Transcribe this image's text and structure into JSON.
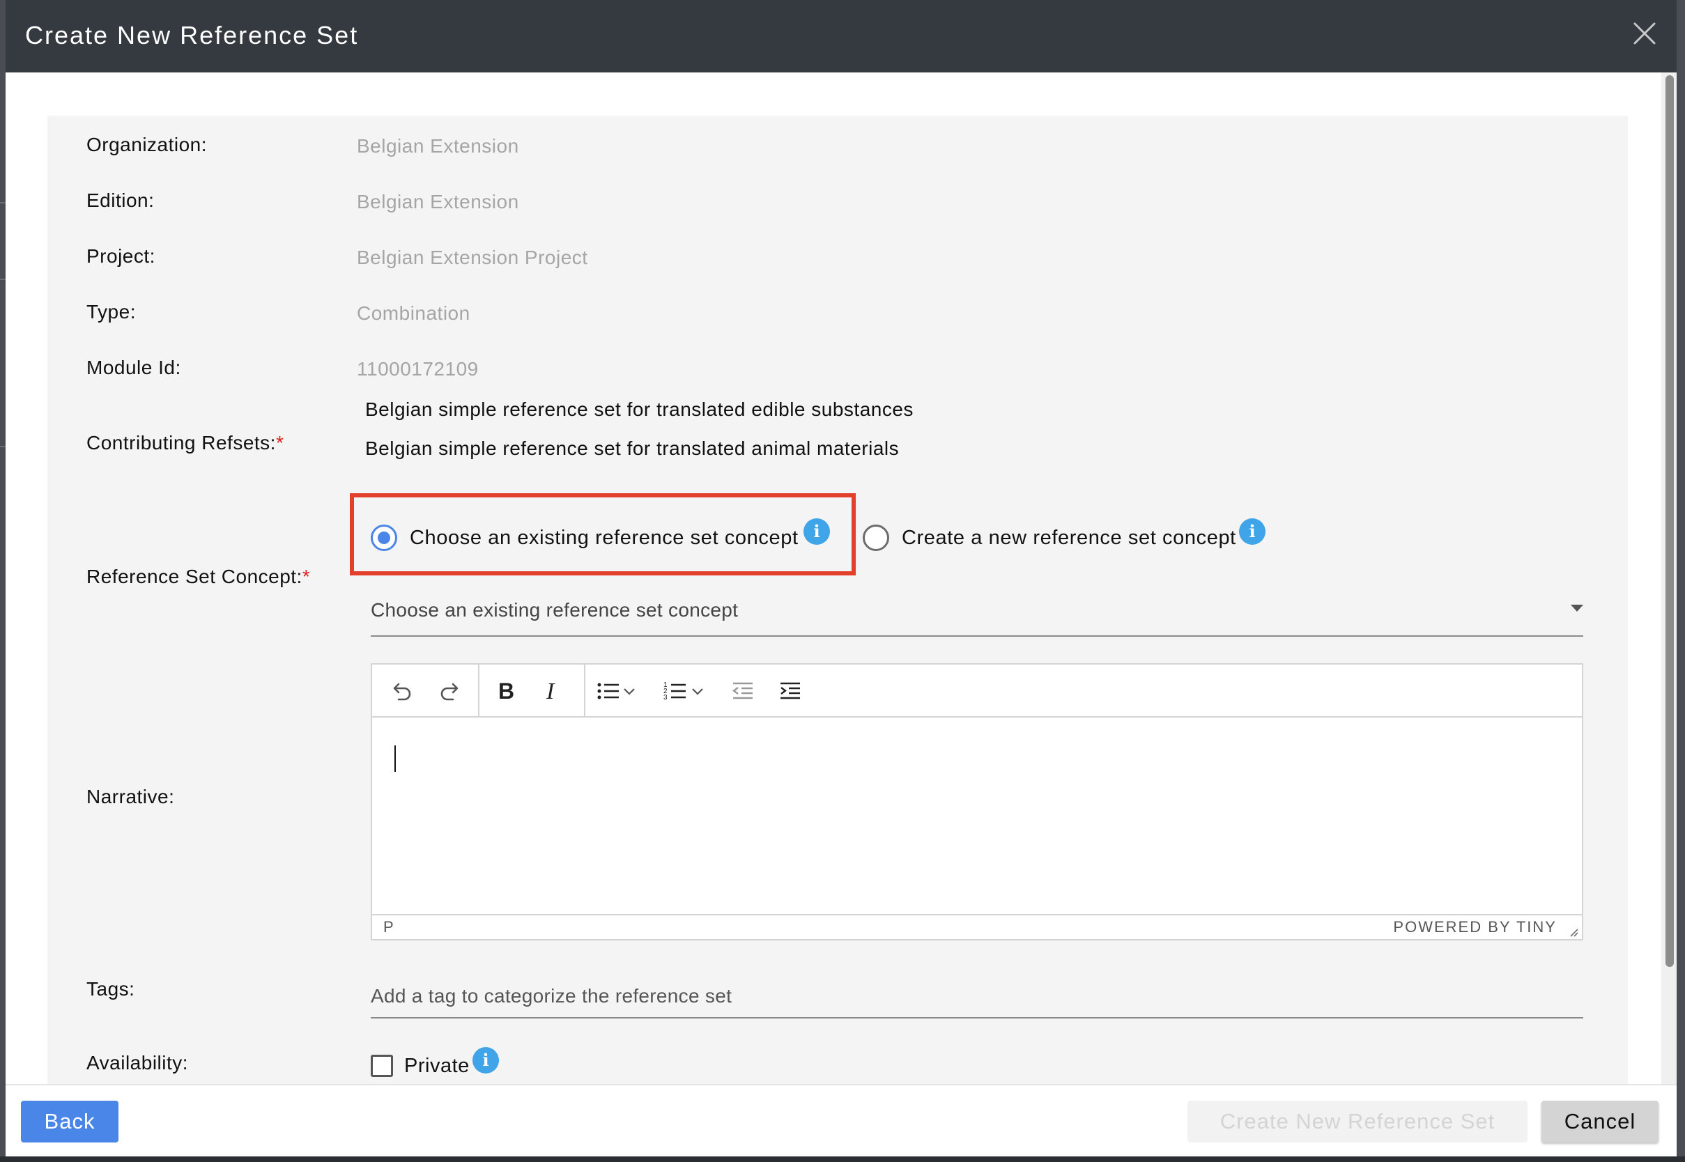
{
  "modal": {
    "title": "Create New Reference Set"
  },
  "fields": {
    "organization": {
      "label": "Organization:",
      "value": "Belgian Extension"
    },
    "edition": {
      "label": "Edition:",
      "value": "Belgian Extension"
    },
    "project": {
      "label": "Project:",
      "value": "Belgian Extension Project"
    },
    "type": {
      "label": "Type:",
      "value": "Combination"
    },
    "module_id": {
      "label": "Module Id:",
      "value": "11000172109"
    },
    "contributing_refsets": {
      "label": "Contributing Refsets:",
      "required_mark": "*",
      "items": [
        "Belgian simple reference set for translated edible substances",
        "Belgian simple reference set for translated animal materials"
      ]
    },
    "reference_set_concept": {
      "label": "Reference Set Concept:",
      "required_mark": "*",
      "options": [
        {
          "label": "Choose an existing reference set concept",
          "selected": true
        },
        {
          "label": "Create a new reference set concept",
          "selected": false
        }
      ],
      "select_placeholder": "Choose an existing reference set concept"
    },
    "narrative": {
      "label": "Narrative:",
      "status_path": "P",
      "status_brand": "POWERED BY TINY"
    },
    "tags": {
      "label": "Tags:",
      "placeholder": "Add a tag to categorize the reference set"
    },
    "availability": {
      "label": "Availability:",
      "checkbox_label": "Private",
      "checked": false
    }
  },
  "info_icon_glyph": "i",
  "footer": {
    "back_label": "Back",
    "create_label": "Create New Reference Set",
    "cancel_label": "Cancel"
  },
  "colors": {
    "header_bg": "#343a40",
    "accent": "#4a86e8",
    "highlight": "#e2402a",
    "info": "#3fa4e8"
  }
}
